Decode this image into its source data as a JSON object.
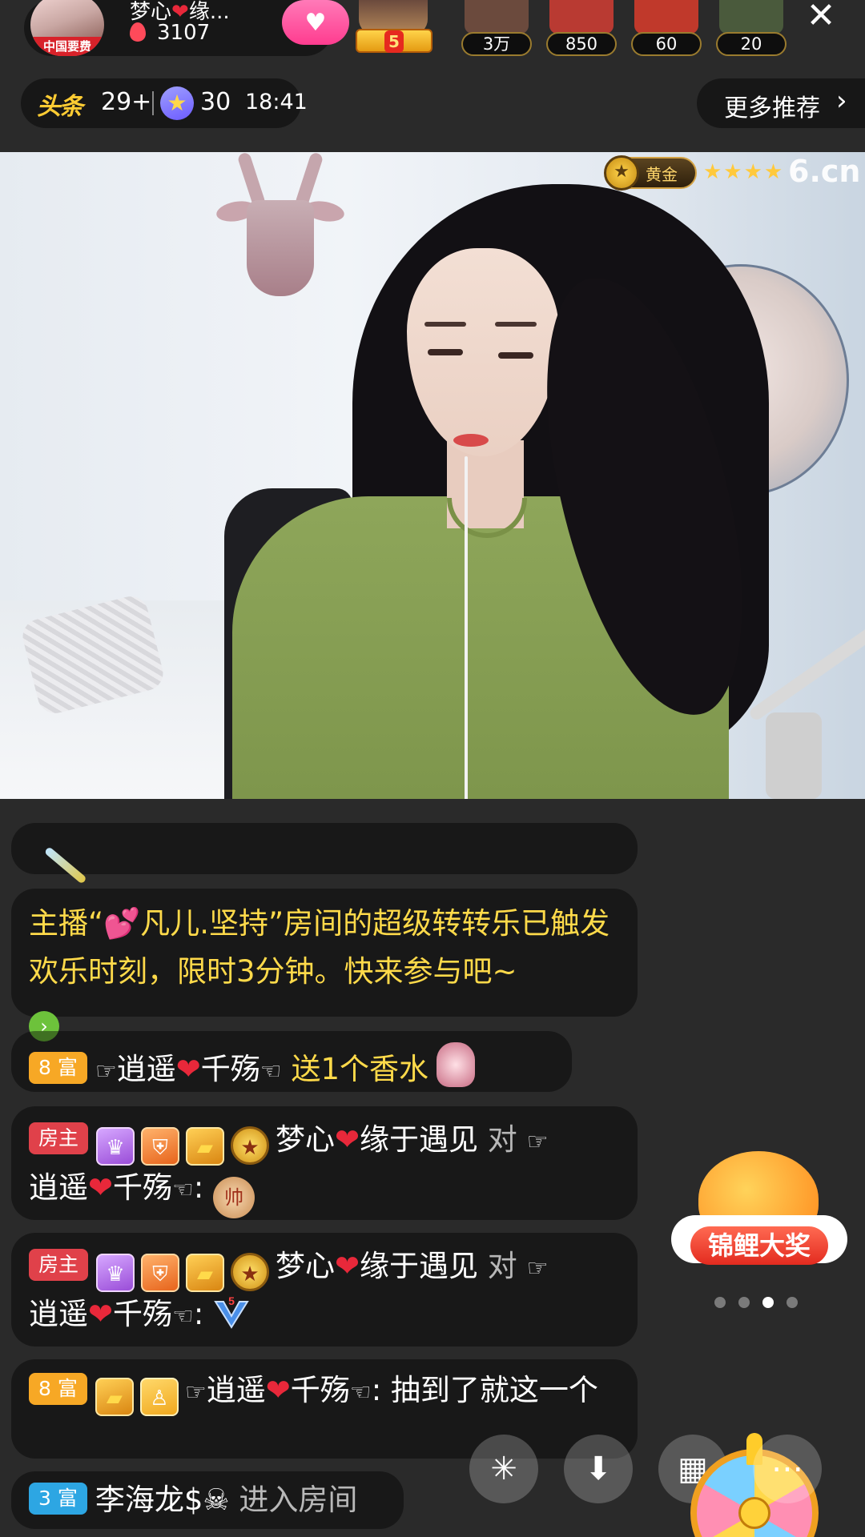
{
  "header": {
    "host_name_part1": "梦心",
    "host_name_heart": "❤",
    "host_name_part2": "缘...",
    "host_avatar_ribbon": "中国要费",
    "host_hot_count": "3107",
    "follow_icon": "heart-icon",
    "crown_badge_level": "5",
    "viewers": [
      {
        "count": "3万",
        "color": "#6b4a3d"
      },
      {
        "count": "850",
        "color": "#b93a32"
      },
      {
        "count": "60",
        "color": "#c0392b"
      },
      {
        "count": "20",
        "color": "#4a5a3c"
      }
    ],
    "close_label": "✕"
  },
  "subbar": {
    "toutiao_logo": "头条",
    "toutiao_count": "29+",
    "star_count": "30",
    "time": "18:41",
    "more_label": "更多推荐",
    "more_chevron": "›"
  },
  "video": {
    "gold_badge_label": "黄金",
    "gold_stars": "★★★★",
    "watermark": "6.cn"
  },
  "chat": {
    "system_message": {
      "prefix": "主播“",
      "emoji": "💕",
      "host": "凡儿.坚持",
      "text": "”房间的超级转转乐已触发欢乐时刻，限时3分钟。快来参与吧~",
      "arrow": "›"
    },
    "gift_message": {
      "tag": "8 富",
      "hand_left": "☞",
      "user_part1": "逍遥",
      "heart": "❤",
      "user_part2": "千殇",
      "hand_right": "☜",
      "action": "送1个香水"
    },
    "host_message_1": {
      "tag": "房主",
      "sender_part1": "梦心",
      "heart": "❤",
      "sender_part2": "缘于遇见",
      "to_word": "对",
      "hand_left": "☞",
      "target_part1": "逍遥",
      "target_heart": "❤",
      "target_part2": "千殇",
      "hand_right": "☜",
      "colon": ":",
      "emoji_text": "帅"
    },
    "host_message_2": {
      "tag": "房主",
      "sender_part1": "梦心",
      "heart": "❤",
      "sender_part2": "缘于遇见",
      "to_word": "对",
      "hand_left": "☞",
      "target_part1": "逍遥",
      "target_heart": "❤",
      "target_part2": "千殇",
      "hand_right": "☜",
      "colon": ":",
      "emoji_text": "5"
    },
    "user_message": {
      "tag": "8 富",
      "hand_left": "☞",
      "user_part1": "逍遥",
      "heart": "❤",
      "user_part2": "千殇",
      "hand_right": "☜",
      "text": ": 抽到了就这一个"
    },
    "enter_message": {
      "tag": "3 富",
      "user": "李海龙$",
      "skull": "☠",
      "text": "进入房间"
    }
  },
  "side": {
    "koi_label": "锦鲤大奖",
    "carousel_active_index": 2,
    "carousel_count": 4
  },
  "bottom_bar": {
    "sparkle_icon": "✳",
    "download_icon": "⬇",
    "grid_icon": "▦",
    "more_icon": "⋯"
  }
}
